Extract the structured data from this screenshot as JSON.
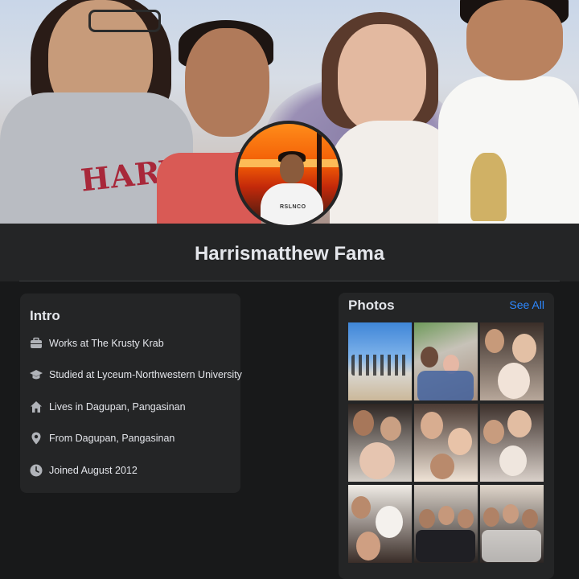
{
  "profile": {
    "name": "Harrismatthew Fama",
    "avatar_shirt_text": "RSLNCO"
  },
  "cover": {
    "shirt_text": "HARVARD"
  },
  "intro": {
    "title": "Intro",
    "items": [
      {
        "icon": "briefcase-icon",
        "text": "Works at The Krusty Krab"
      },
      {
        "icon": "graduation-cap-icon",
        "text": "Studied at Lyceum-Northwestern University"
      },
      {
        "icon": "home-icon",
        "text": "Lives in Dagupan, Pangasinan"
      },
      {
        "icon": "location-pin-icon",
        "text": "From Dagupan, Pangasinan"
      },
      {
        "icon": "clock-icon",
        "text": "Joined August 2012"
      }
    ]
  },
  "photos": {
    "title": "Photos",
    "see_all_label": "See All"
  },
  "colors": {
    "background": "#18191a",
    "card": "#242526",
    "text": "#e4e6eb",
    "link": "#2d88ff",
    "icon": "#b0b3b8"
  }
}
